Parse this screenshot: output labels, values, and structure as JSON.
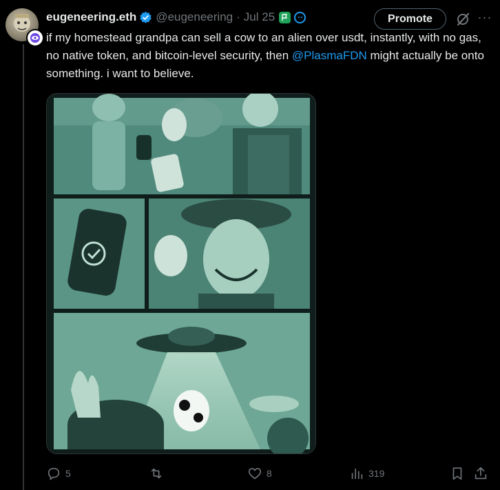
{
  "tweet": {
    "display_name": "eugeneering.eth",
    "handle": "@eugeneering",
    "separator": "·",
    "date": "Jul 25",
    "text_before_mention": "if my homestead grandpa can sell a cow to an alien over usdt, instantly, with no gas, no native token, and bitcoin-level security, then ",
    "mention": "@PlasmaFDN",
    "text_after_mention": " might actually be onto something. i want to believe.",
    "promote_label": "Promote",
    "more_label": "···"
  },
  "actions": {
    "replies": "5",
    "retweets": "",
    "likes": "8",
    "views": "319"
  },
  "colors": {
    "accent": "#1d9bf0",
    "background": "#000000",
    "text": "#e7e9ea",
    "muted": "#71767b",
    "verified": "#1d9bf0",
    "flag_badge": "#1fa25a",
    "media_tint": "#4f8a7c"
  },
  "icons": {
    "verified": "verified-badge-icon",
    "flag": "flag-icon",
    "emoji": "emoji-badge-icon",
    "grok": "grok-icon",
    "more": "more-icon",
    "reply": "reply-icon",
    "retweet": "retweet-icon",
    "like": "heart-icon",
    "views": "views-icon",
    "bookmark": "bookmark-icon",
    "share": "share-icon"
  }
}
